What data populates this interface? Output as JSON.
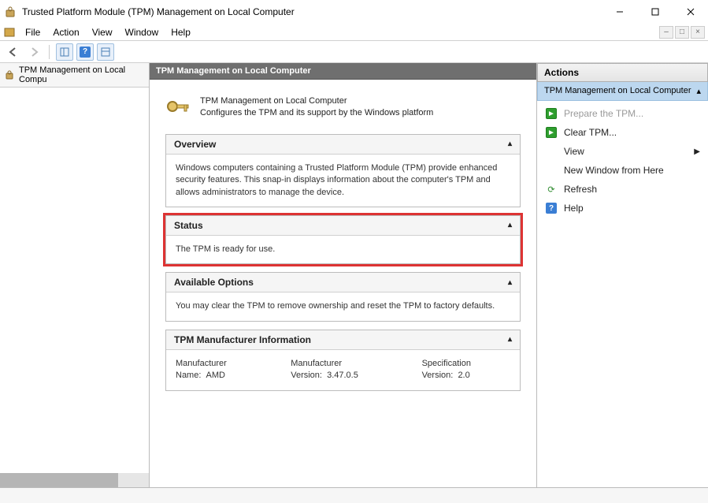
{
  "titlebar": {
    "title": "Trusted Platform Module (TPM) Management on Local Computer"
  },
  "menu": {
    "file": "File",
    "action": "Action",
    "view": "View",
    "window": "Window",
    "help": "Help"
  },
  "left_panel": {
    "header": "TPM Management on Local Compu"
  },
  "center": {
    "header": "TPM Management on Local Computer",
    "intro_title": "TPM Management on Local Computer",
    "intro_text": "Configures the TPM and its support by the Windows platform",
    "overview": {
      "title": "Overview",
      "text": "Windows computers containing a Trusted Platform Module (TPM) provide enhanced security features. This snap-in displays information about the computer's TPM and allows administrators to manage the device."
    },
    "status": {
      "title": "Status",
      "text": "The TPM is ready for use."
    },
    "available": {
      "title": "Available Options",
      "text": "You may clear the TPM to remove ownership and reset the TPM to factory defaults."
    },
    "manuf": {
      "title": "TPM Manufacturer Information",
      "name_label": "Manufacturer Name:",
      "name_value": "AMD",
      "ver_label": "Manufacturer Version:",
      "ver_value": "3.47.0.5",
      "spec_label": "Specification Version:",
      "spec_value": "2.0"
    }
  },
  "actions": {
    "header": "Actions",
    "subheader": "TPM Management on Local Computer",
    "items": {
      "prepare": "Prepare the TPM...",
      "clear": "Clear TPM...",
      "view": "View",
      "new_window": "New Window from Here",
      "refresh": "Refresh",
      "help": "Help"
    }
  }
}
